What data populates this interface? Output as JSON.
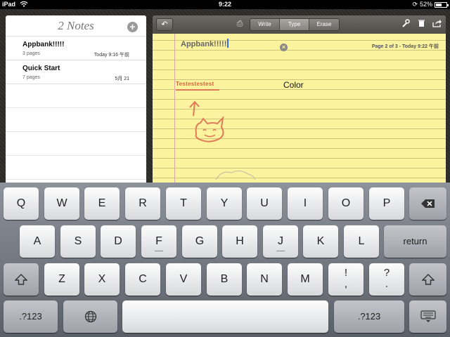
{
  "status_bar": {
    "carrier": "iPad",
    "time": "9:22",
    "battery": "52%"
  },
  "notes_list": {
    "title": "2 Notes",
    "add_label": "+",
    "notes": [
      {
        "title": "Appbank!!!!!",
        "pages": "3 pages",
        "date": "Today 9:16 午前"
      },
      {
        "title": "Quick Start",
        "pages": "7 pages",
        "date": "5月 21"
      }
    ]
  },
  "toolbar": {
    "back_icon": "undo-icon",
    "modes": [
      "Write",
      "Type",
      "Erase"
    ],
    "active_mode": "Type",
    "icons": [
      "wrench-icon",
      "trash-icon",
      "share-icon"
    ]
  },
  "editor": {
    "note_title": "Appbank!!!!!",
    "page_info": "Page 2 of 3 - Today 9:22 午前",
    "drawn_text": "Testestestest",
    "color_label": "Color"
  },
  "keyboard": {
    "row1": [
      "Q",
      "W",
      "E",
      "R",
      "T",
      "Y",
      "U",
      "I",
      "O",
      "P"
    ],
    "row2": [
      "A",
      "S",
      "D",
      "F",
      "G",
      "H",
      "J",
      "K",
      "L"
    ],
    "row3": [
      "Z",
      "X",
      "C",
      "V",
      "B",
      "N",
      "M"
    ],
    "return_label": "return",
    "numbers_label": ".?123",
    "punct1": {
      "top": "!",
      "bottom": ","
    },
    "punct2": {
      "top": "?",
      "bottom": "."
    },
    "special_icons": [
      "backspace-icon",
      "shift-icon",
      "globe-icon",
      "hide-keyboard-icon"
    ]
  }
}
